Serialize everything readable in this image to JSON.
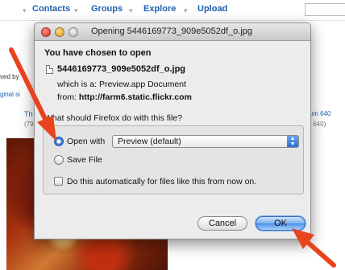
{
  "nav": {
    "contacts": "Contacts",
    "groups": "Groups",
    "explore": "Explore",
    "upload": "Upload",
    "dropdown_glyph": "▾"
  },
  "background_page": {
    "left_fragments": [
      "ved by",
      "ginal si",
      "Th",
      "(79"
    ],
    "right_fragments": [
      "ium 640",
      "x 640)"
    ],
    "link_color": "#1f5fb0"
  },
  "dialog": {
    "title": "Opening 5446169773_909e5052df_o.jpg",
    "heading": "You have chosen to open",
    "file_name": "5446169773_909e5052df_o.jpg",
    "which_is_label": "which is a:",
    "which_is_value": "Preview.app Document",
    "from_label": "from:",
    "from_value": "http://farm6.static.flickr.com",
    "question": "What should Firefox do with this file?",
    "open_with_label": "Open with",
    "open_with_value": "Preview (default)",
    "save_file_label": "Save File",
    "auto_label": "Do this automatically for files like this from now on.",
    "cancel_label": "Cancel",
    "ok_label": "OK",
    "selected_option": "open_with",
    "auto_checked": false
  },
  "annotation": {
    "arrow_color": "#e8431e",
    "icon": "red-arrow-icon"
  }
}
